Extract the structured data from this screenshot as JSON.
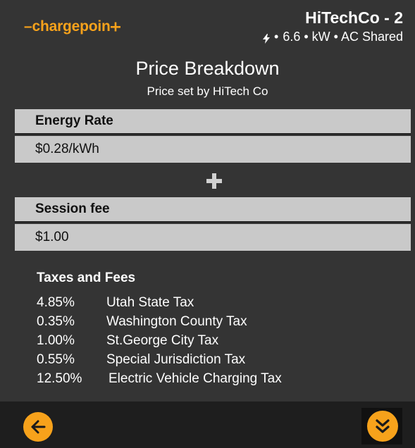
{
  "header": {
    "logo_text": "chargepoin",
    "station_name": "HiTechCo - 2",
    "station_specs": "6.6 • kW • AC Shared"
  },
  "page": {
    "title": "Price Breakdown",
    "subtitle": "Price set by HiTech Co"
  },
  "pricing": {
    "energy_rate_label": "Energy Rate",
    "energy_rate_value": "$0.28/kWh",
    "session_fee_label": "Session fee",
    "session_fee_value": "$1.00"
  },
  "taxes": {
    "heading": "Taxes and Fees",
    "items": [
      {
        "percent": "4.85%",
        "name": "Utah State Tax"
      },
      {
        "percent": "0.35%",
        "name": "Washington County Tax"
      },
      {
        "percent": "1.00%",
        "name": "St.George City Tax"
      },
      {
        "percent": "0.55%",
        "name": "Special Jurisdiction Tax"
      },
      {
        "percent": "12.50%",
        "name": "Electric Vehicle Charging Tax"
      }
    ]
  },
  "icons": {
    "back": "arrow-left-icon",
    "scroll": "double-chevron-down-icon",
    "plus": "plus-icon",
    "bolt": "lightning-bolt-icon"
  },
  "colors": {
    "accent": "#f7a21b",
    "background": "#343434",
    "panel": "#c9c9c9",
    "footer": "#1e1e1e"
  }
}
